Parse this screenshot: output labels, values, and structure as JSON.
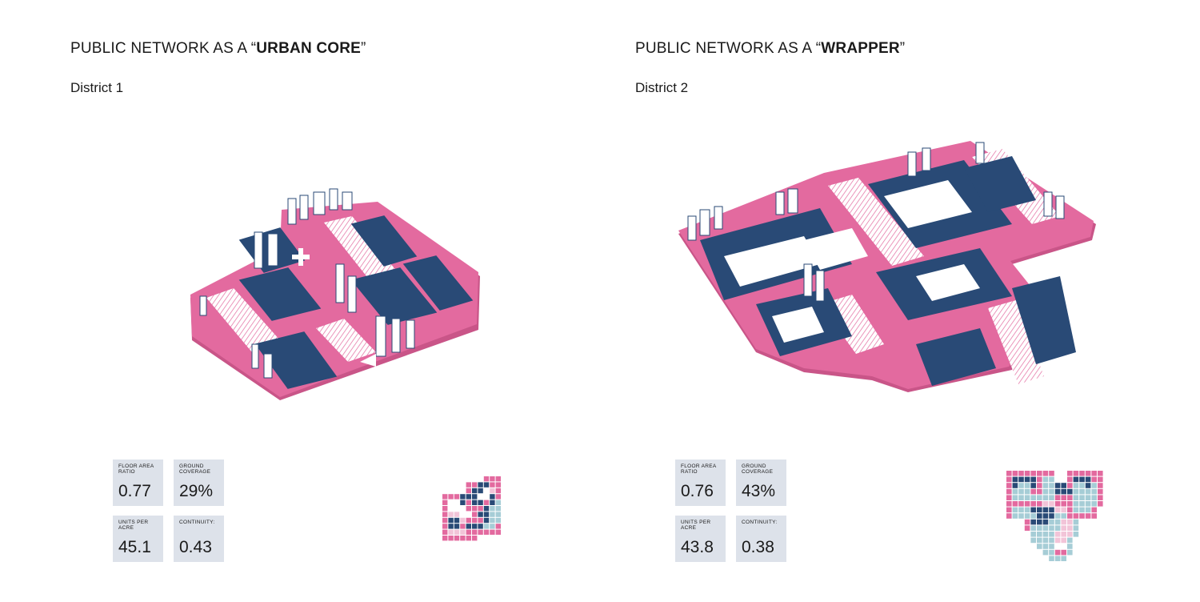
{
  "colors": {
    "pink": "#e36a9f",
    "navy": "#294a76",
    "light_blue": "#a6cdd6",
    "light_pink": "#f2c4d8",
    "stat_bg": "#dde2ea"
  },
  "district1": {
    "title_prefix": "PUBLIC NETWORK AS A “",
    "title_bold": "URBAN CORE",
    "title_suffix": "”",
    "subtitle": "District 1",
    "stats": {
      "far_label": "FLOOR AREA RATIO",
      "far_value": "0.77",
      "gc_label": "GROUND COVERAGE",
      "gc_value": "29%",
      "upa_label": "UNITS PER ACRE",
      "upa_value": "45.1",
      "cont_label": "CONTINUITY:",
      "cont_value": "0.43"
    }
  },
  "district2": {
    "title_prefix": "PUBLIC NETWORK AS A “",
    "title_bold": "WRAPPER",
    "title_suffix": "”",
    "subtitle": "District 2",
    "stats": {
      "far_label": "FLOOR AREA RATIO",
      "far_value": "0.76",
      "gc_label": "GROUND COVERAGE",
      "gc_value": "43%",
      "upa_label": "UNITS PER ACRE",
      "upa_value": "43.8",
      "cont_label": "CONTINUITY:",
      "cont_value": "0.38"
    }
  }
}
